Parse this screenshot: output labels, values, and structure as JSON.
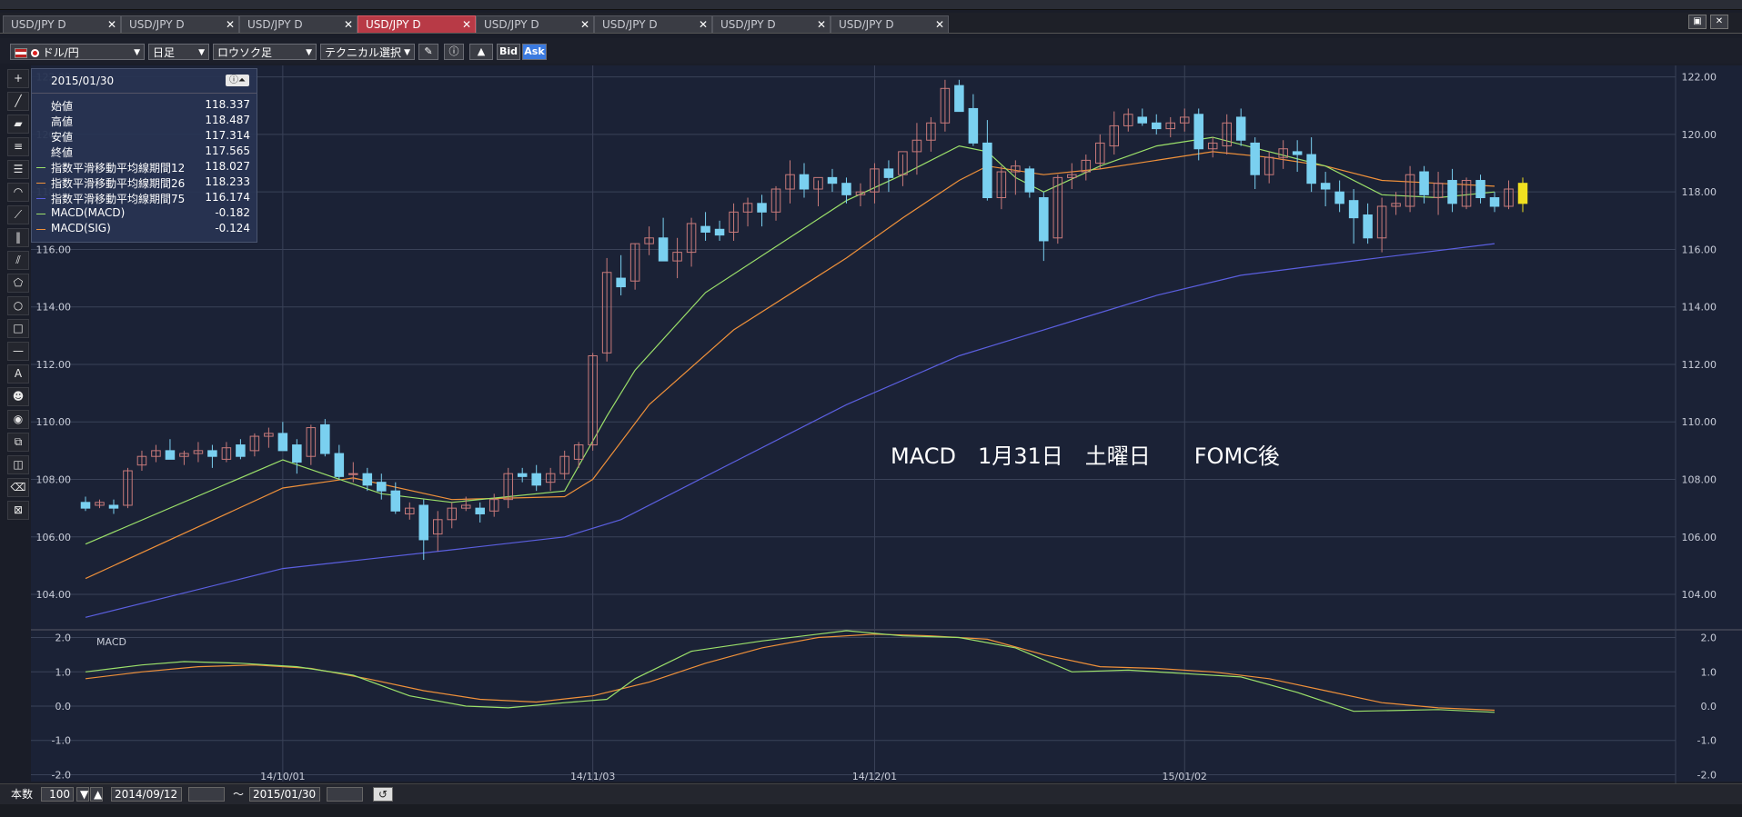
{
  "tabs": [
    {
      "label": "USD/JPY D",
      "active": false
    },
    {
      "label": "USD/JPY D",
      "active": false
    },
    {
      "label": "USD/JPY D",
      "active": false
    },
    {
      "label": "USD/JPY D",
      "active": true
    },
    {
      "label": "USD/JPY D",
      "active": false
    },
    {
      "label": "USD/JPY D",
      "active": false
    },
    {
      "label": "USD/JPY D",
      "active": false
    },
    {
      "label": "USD/JPY D",
      "active": false
    }
  ],
  "toolbar": {
    "currency_pair": "ドル/円",
    "timeframe": "日足",
    "chart_type": "ロウソク足",
    "technical_select": "テクニカル選択",
    "bid_label": "Bid",
    "ask_label": "Ask"
  },
  "info": {
    "date": "2015/01/30",
    "rows": [
      {
        "label": "始値",
        "value": "118.337",
        "color": ""
      },
      {
        "label": "高値",
        "value": "118.487",
        "color": ""
      },
      {
        "label": "安値",
        "value": "117.314",
        "color": ""
      },
      {
        "label": "終値",
        "value": "117.565",
        "color": ""
      },
      {
        "label": "指数平滑移動平均線期間12",
        "value": "118.027",
        "color": "#9be06a"
      },
      {
        "label": "指数平滑移動平均線期間26",
        "value": "118.233",
        "color": "#f0913a"
      },
      {
        "label": "指数平滑移動平均線期間75",
        "value": "116.174",
        "color": "#5b5fe0"
      },
      {
        "label": "MACD(MACD)",
        "value": "-0.182",
        "color": "#9be06a"
      },
      {
        "label": "MACD(SIG)",
        "value": "-0.124",
        "color": "#f0913a"
      }
    ]
  },
  "annotation": "MACD　1月31日　土曜日　　FOMC後",
  "macd_label": "MACD",
  "bottom": {
    "count_label": "本数",
    "count_value": "100",
    "start_date": "2014/09/12",
    "tilde": "～",
    "end_date": "2015/01/30"
  },
  "chart_data": {
    "type": "candlestick",
    "price_axis": {
      "ticks": [
        "122.00",
        "120.00",
        "118.00",
        "116.00",
        "114.00",
        "112.00",
        "110.00",
        "108.00",
        "106.00",
        "104.00"
      ],
      "ylim": [
        102.8,
        122.4
      ]
    },
    "macd_axis": {
      "ticks": [
        "2.0",
        "1.0",
        "0.0",
        "-1.0",
        "-2.0"
      ],
      "ylim": [
        -2.2,
        2.2
      ]
    },
    "x_ticks": [
      {
        "label": "14/10/01",
        "index": 14
      },
      {
        "label": "14/11/03",
        "index": 36
      },
      {
        "label": "14/12/01",
        "index": 56
      },
      {
        "label": "15/01/02",
        "index": 78
      }
    ],
    "colors": {
      "up": "#c87a7a",
      "down": "#7ad0f0",
      "last": "#f0e020",
      "ema12": "#9be06a",
      "ema26": "#f0913a",
      "ema75": "#5b5fe0"
    },
    "candles": [
      [
        107.2,
        107.4,
        106.9,
        107.0
      ],
      [
        107.1,
        107.3,
        107.0,
        107.2
      ],
      [
        107.1,
        107.3,
        106.8,
        107.0
      ],
      [
        107.1,
        108.4,
        107.0,
        108.3
      ],
      [
        108.5,
        109.0,
        108.3,
        108.8
      ],
      [
        108.8,
        109.2,
        108.6,
        109.0
      ],
      [
        109.0,
        109.4,
        108.7,
        108.7
      ],
      [
        108.8,
        109.0,
        108.5,
        108.9
      ],
      [
        108.9,
        109.3,
        108.6,
        109.0
      ],
      [
        109.0,
        109.2,
        108.4,
        108.8
      ],
      [
        108.7,
        109.3,
        108.6,
        109.1
      ],
      [
        109.2,
        109.4,
        108.7,
        108.8
      ],
      [
        109.0,
        109.6,
        108.8,
        109.5
      ],
      [
        109.5,
        109.8,
        109.1,
        109.6
      ],
      [
        109.6,
        110.0,
        109.0,
        109.0
      ],
      [
        109.2,
        109.4,
        108.2,
        108.6
      ],
      [
        108.8,
        109.9,
        108.5,
        109.8
      ],
      [
        109.9,
        110.1,
        108.8,
        108.9
      ],
      [
        108.9,
        109.2,
        108.0,
        108.1
      ],
      [
        108.2,
        108.6,
        107.9,
        108.2
      ],
      [
        108.2,
        108.4,
        107.6,
        107.8
      ],
      [
        107.9,
        108.2,
        107.3,
        107.6
      ],
      [
        107.6,
        107.9,
        106.8,
        106.9
      ],
      [
        106.8,
        107.2,
        106.6,
        107.0
      ],
      [
        107.1,
        107.3,
        105.2,
        105.9
      ],
      [
        106.1,
        106.9,
        105.5,
        106.6
      ],
      [
        106.6,
        107.2,
        106.3,
        107.0
      ],
      [
        107.0,
        107.4,
        106.9,
        107.1
      ],
      [
        107.0,
        107.2,
        106.5,
        106.8
      ],
      [
        106.9,
        107.5,
        106.7,
        107.3
      ],
      [
        107.3,
        108.4,
        107.0,
        108.2
      ],
      [
        108.2,
        108.4,
        107.9,
        108.1
      ],
      [
        108.2,
        108.5,
        107.6,
        107.8
      ],
      [
        107.9,
        108.4,
        107.6,
        108.2
      ],
      [
        108.2,
        109.0,
        108.0,
        108.8
      ],
      [
        108.7,
        109.3,
        108.4,
        109.2
      ],
      [
        109.2,
        112.4,
        109.0,
        112.3
      ],
      [
        112.4,
        115.7,
        112.1,
        115.2
      ],
      [
        115.0,
        115.8,
        114.4,
        114.7
      ],
      [
        114.9,
        116.2,
        114.6,
        116.2
      ],
      [
        116.2,
        116.8,
        115.8,
        116.4
      ],
      [
        116.4,
        117.1,
        116.0,
        115.6
      ],
      [
        115.6,
        116.4,
        115.0,
        115.9
      ],
      [
        115.9,
        117.1,
        115.4,
        116.9
      ],
      [
        116.8,
        117.3,
        116.3,
        116.6
      ],
      [
        116.7,
        117.0,
        116.3,
        116.5
      ],
      [
        116.6,
        117.6,
        116.3,
        117.3
      ],
      [
        117.3,
        117.8,
        116.8,
        117.6
      ],
      [
        117.6,
        117.9,
        116.8,
        117.3
      ],
      [
        117.3,
        118.2,
        117.0,
        118.1
      ],
      [
        118.1,
        119.1,
        117.6,
        118.6
      ],
      [
        118.6,
        119.0,
        117.8,
        118.1
      ],
      [
        118.1,
        118.4,
        117.5,
        118.5
      ],
      [
        118.5,
        118.8,
        118.0,
        118.3
      ],
      [
        118.3,
        118.5,
        117.6,
        117.9
      ],
      [
        117.9,
        118.3,
        117.5,
        118.0
      ],
      [
        118.0,
        119.0,
        117.6,
        118.8
      ],
      [
        118.8,
        119.1,
        118.0,
        118.5
      ],
      [
        118.6,
        119.3,
        118.2,
        119.4
      ],
      [
        119.4,
        120.4,
        118.6,
        119.8
      ],
      [
        119.8,
        120.6,
        119.4,
        120.4
      ],
      [
        120.4,
        121.9,
        120.1,
        121.6
      ],
      [
        121.7,
        121.9,
        120.8,
        120.8
      ],
      [
        120.9,
        121.4,
        119.6,
        119.7
      ],
      [
        119.7,
        120.5,
        117.7,
        117.8
      ],
      [
        117.8,
        118.9,
        117.4,
        118.7
      ],
      [
        118.7,
        119.1,
        117.9,
        118.9
      ],
      [
        118.8,
        118.9,
        117.8,
        118.0
      ],
      [
        117.8,
        118.0,
        115.6,
        116.3
      ],
      [
        116.4,
        118.6,
        116.2,
        118.5
      ],
      [
        118.5,
        119.0,
        118.1,
        118.6
      ],
      [
        118.7,
        119.3,
        118.4,
        119.1
      ],
      [
        119.0,
        120.0,
        118.8,
        119.7
      ],
      [
        119.6,
        120.8,
        119.3,
        120.3
      ],
      [
        120.3,
        120.9,
        120.1,
        120.7
      ],
      [
        120.6,
        120.9,
        120.3,
        120.4
      ],
      [
        120.4,
        120.7,
        120.0,
        120.2
      ],
      [
        120.2,
        120.6,
        119.9,
        120.4
      ],
      [
        120.4,
        120.9,
        120.1,
        120.6
      ],
      [
        120.7,
        120.9,
        119.1,
        119.5
      ],
      [
        119.5,
        119.9,
        119.2,
        119.7
      ],
      [
        119.6,
        120.7,
        119.3,
        120.4
      ],
      [
        120.6,
        120.9,
        119.6,
        119.8
      ],
      [
        119.7,
        119.9,
        118.1,
        118.6
      ],
      [
        118.6,
        119.4,
        118.3,
        119.2
      ],
      [
        119.2,
        119.8,
        118.8,
        119.5
      ],
      [
        119.4,
        119.8,
        118.7,
        119.3
      ],
      [
        119.3,
        119.9,
        118.0,
        118.3
      ],
      [
        118.3,
        118.7,
        117.5,
        118.1
      ],
      [
        118.0,
        118.4,
        117.3,
        117.6
      ],
      [
        117.7,
        118.1,
        116.2,
        117.1
      ],
      [
        117.2,
        117.6,
        116.2,
        116.4
      ],
      [
        116.4,
        117.8,
        115.9,
        117.5
      ],
      [
        117.5,
        118.0,
        117.2,
        117.6
      ],
      [
        117.5,
        118.9,
        117.3,
        118.6
      ],
      [
        118.7,
        118.9,
        117.6,
        117.9
      ],
      [
        117.8,
        118.7,
        117.2,
        118.3
      ],
      [
        118.4,
        118.8,
        117.3,
        117.6
      ],
      [
        117.5,
        118.5,
        117.4,
        118.4
      ],
      [
        118.4,
        118.6,
        117.6,
        117.8
      ],
      [
        117.8,
        118.0,
        117.3,
        117.5
      ],
      [
        117.5,
        118.4,
        117.4,
        118.1
      ],
      [
        118.3,
        118.5,
        117.3,
        117.6
      ]
    ],
    "ema12": [
      [
        0,
        105.75
      ],
      [
        14,
        108.68
      ],
      [
        21,
        107.5
      ],
      [
        26,
        107.2
      ],
      [
        34,
        107.6
      ],
      [
        37,
        110.2
      ],
      [
        39,
        111.8
      ],
      [
        44,
        114.5
      ],
      [
        54,
        117.7
      ],
      [
        58,
        118.6
      ],
      [
        62,
        119.6
      ],
      [
        64,
        119.4
      ],
      [
        66,
        118.5
      ],
      [
        68,
        118.0
      ],
      [
        72,
        118.9
      ],
      [
        76,
        119.6
      ],
      [
        80,
        119.9
      ],
      [
        84,
        119.4
      ],
      [
        88,
        118.9
      ],
      [
        92,
        117.9
      ],
      [
        96,
        117.8
      ],
      [
        100,
        118.0
      ]
    ],
    "ema26": [
      [
        0,
        104.55
      ],
      [
        14,
        107.7
      ],
      [
        19,
        108.05
      ],
      [
        26,
        107.3
      ],
      [
        34,
        107.4
      ],
      [
        36,
        108.0
      ],
      [
        40,
        110.6
      ],
      [
        46,
        113.2
      ],
      [
        54,
        115.7
      ],
      [
        58,
        117.1
      ],
      [
        62,
        118.4
      ],
      [
        64,
        118.9
      ],
      [
        68,
        118.6
      ],
      [
        72,
        118.8
      ],
      [
        76,
        119.1
      ],
      [
        80,
        119.4
      ],
      [
        84,
        119.2
      ],
      [
        88,
        118.9
      ],
      [
        92,
        118.4
      ],
      [
        96,
        118.3
      ],
      [
        100,
        118.2
      ]
    ],
    "ema75": [
      [
        0,
        103.2
      ],
      [
        14,
        104.9
      ],
      [
        26,
        105.55
      ],
      [
        34,
        106.0
      ],
      [
        38,
        106.6
      ],
      [
        46,
        108.6
      ],
      [
        54,
        110.6
      ],
      [
        62,
        112.3
      ],
      [
        70,
        113.5
      ],
      [
        76,
        114.4
      ],
      [
        82,
        115.1
      ],
      [
        90,
        115.6
      ],
      [
        100,
        116.2
      ]
    ],
    "macd": [
      [
        0,
        1.0
      ],
      [
        4,
        1.2
      ],
      [
        7,
        1.3
      ],
      [
        11,
        1.25
      ],
      [
        15,
        1.15
      ],
      [
        19,
        0.9
      ],
      [
        23,
        0.3
      ],
      [
        27,
        0.0
      ],
      [
        30,
        -0.05
      ],
      [
        34,
        0.1
      ],
      [
        37,
        0.2
      ],
      [
        39,
        0.8
      ],
      [
        43,
        1.6
      ],
      [
        48,
        1.9
      ],
      [
        54,
        2.2
      ],
      [
        58,
        2.05
      ],
      [
        62,
        2.0
      ],
      [
        66,
        1.7
      ],
      [
        70,
        1.0
      ],
      [
        74,
        1.05
      ],
      [
        78,
        0.95
      ],
      [
        82,
        0.85
      ],
      [
        86,
        0.4
      ],
      [
        90,
        -0.15
      ],
      [
        96,
        -0.1
      ],
      [
        100,
        -0.18
      ]
    ],
    "signal": [
      [
        0,
        0.8
      ],
      [
        4,
        1.0
      ],
      [
        8,
        1.15
      ],
      [
        12,
        1.2
      ],
      [
        16,
        1.1
      ],
      [
        20,
        0.8
      ],
      [
        24,
        0.45
      ],
      [
        28,
        0.2
      ],
      [
        32,
        0.12
      ],
      [
        36,
        0.3
      ],
      [
        40,
        0.7
      ],
      [
        44,
        1.25
      ],
      [
        48,
        1.7
      ],
      [
        52,
        2.0
      ],
      [
        56,
        2.1
      ],
      [
        60,
        2.05
      ],
      [
        64,
        1.95
      ],
      [
        68,
        1.5
      ],
      [
        72,
        1.15
      ],
      [
        76,
        1.1
      ],
      [
        80,
        1.0
      ],
      [
        84,
        0.8
      ],
      [
        88,
        0.45
      ],
      [
        92,
        0.1
      ],
      [
        96,
        -0.05
      ],
      [
        100,
        -0.12
      ]
    ]
  }
}
